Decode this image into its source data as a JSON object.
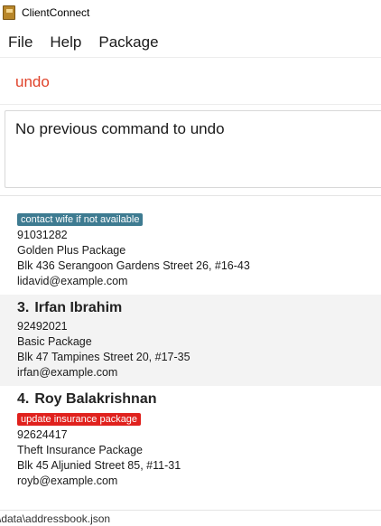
{
  "window": {
    "title": "ClientConnect",
    "app_icon": "address-book-icon"
  },
  "menu": {
    "items": [
      "File",
      "Help",
      "Package"
    ]
  },
  "command": {
    "value": "undo"
  },
  "result": {
    "text": "No previous command to undo"
  },
  "persons": [
    {
      "tag": "contact wife if not available",
      "phone": "91031282",
      "package": "Golden Plus Package",
      "address": "Blk 436 Serangoon Gardens Street 26, #16-43",
      "email": "lidavid@example.com"
    },
    {
      "index": "3.",
      "name": "Irfan Ibrahim",
      "phone": "92492021",
      "package": "Basic Package",
      "address": "Blk 47 Tampines Street 20, #17-35",
      "email": "irfan@example.com"
    },
    {
      "index": "4.",
      "name": "Roy Balakrishnan",
      "tag": "update insurance package",
      "phone": "92624417",
      "package": "Theft Insurance Package",
      "address": "Blk 45 Aljunied Street 85, #11-31",
      "email": "royb@example.com"
    }
  ],
  "status": {
    "path": "\\data\\addressbook.json"
  },
  "colors": {
    "command_text": "#e0432b",
    "tag_teal": "#3e7b91",
    "tag_red": "#e0211d"
  }
}
